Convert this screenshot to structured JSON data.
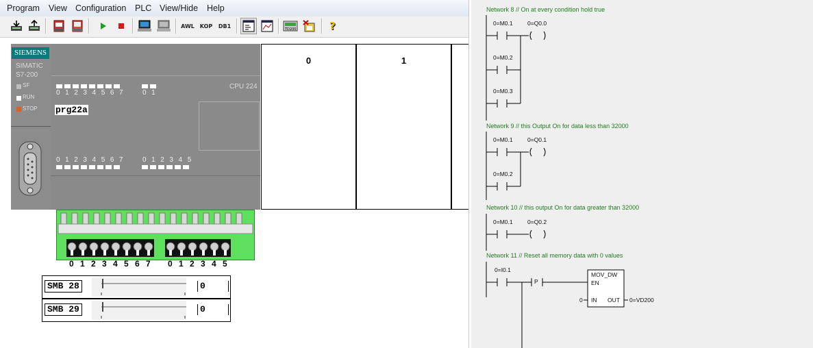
{
  "menu": [
    "Program",
    "View",
    "Configuration",
    "PLC",
    "View/Hide",
    "Help"
  ],
  "toolbar": {
    "text_buttons": [
      "AWL",
      "KOP",
      "DB1"
    ],
    "icons": [
      "download-icon",
      "upload-icon",
      "cpu-red-icon",
      "cpu-red2-icon",
      "run-icon",
      "stop-icon",
      "pc-icon",
      "pc-gray-icon",
      "status-icon",
      "chart-icon",
      "td200-icon",
      "tag-icon",
      "help-icon"
    ]
  },
  "plc": {
    "brand": "SIEMENS",
    "family_line1": "SIMATIC",
    "family_line2": "S7-200",
    "led_sf": "SF",
    "led_run": "RUN",
    "led_stop": "STOP",
    "cpu": "CPU 224",
    "program": "prg22a",
    "in_top_a": "0 1 2 3 4 5 6 7",
    "in_top_b": "0 1",
    "out_bot_a": "0 1 2 3 4 5 6 7",
    "out_bot_b": "0 1 2 3 4 5",
    "modules": [
      "0",
      "1"
    ],
    "switch_nums_a": [
      "0",
      "1",
      "2",
      "3",
      "4",
      "5",
      "6",
      "7"
    ],
    "switch_nums_b": [
      "0",
      "1",
      "2",
      "3",
      "4",
      "5"
    ],
    "stop_color": "#e85a1e",
    "led_on_color": "#ffffff",
    "strip_color": "#5ee05e"
  },
  "sliders": [
    {
      "label": "SMB 28",
      "value": "0"
    },
    {
      "label": "SMB 29",
      "value": "0"
    }
  ],
  "ladder": {
    "n8": {
      "title": "Network 8 // On at every condition hold true",
      "c1": "0=M0.1",
      "coil": "0=Q0.0",
      "c2": "0=M0.2",
      "c3": "0=M0.3"
    },
    "n9": {
      "title": "Network 9 // this Output On for data less than 32000",
      "c1": "0=M0.1",
      "coil": "0=Q0.1",
      "c2": "0=M0.2"
    },
    "n10": {
      "title": "Network 10 // this output On for data greater than 32000",
      "c1": "0=M0.1",
      "coil": "0=Q0.2"
    },
    "n11": {
      "title": "Network 11 // Reset all memory data with 0 values",
      "c1": "0=I0.1",
      "p": "P",
      "box_title": "MOV_DW",
      "en": "EN",
      "in": "IN",
      "out": "OUT",
      "in_val": "0",
      "out_val": "0=VD200"
    },
    "comment_color": "#1f7d1f"
  }
}
